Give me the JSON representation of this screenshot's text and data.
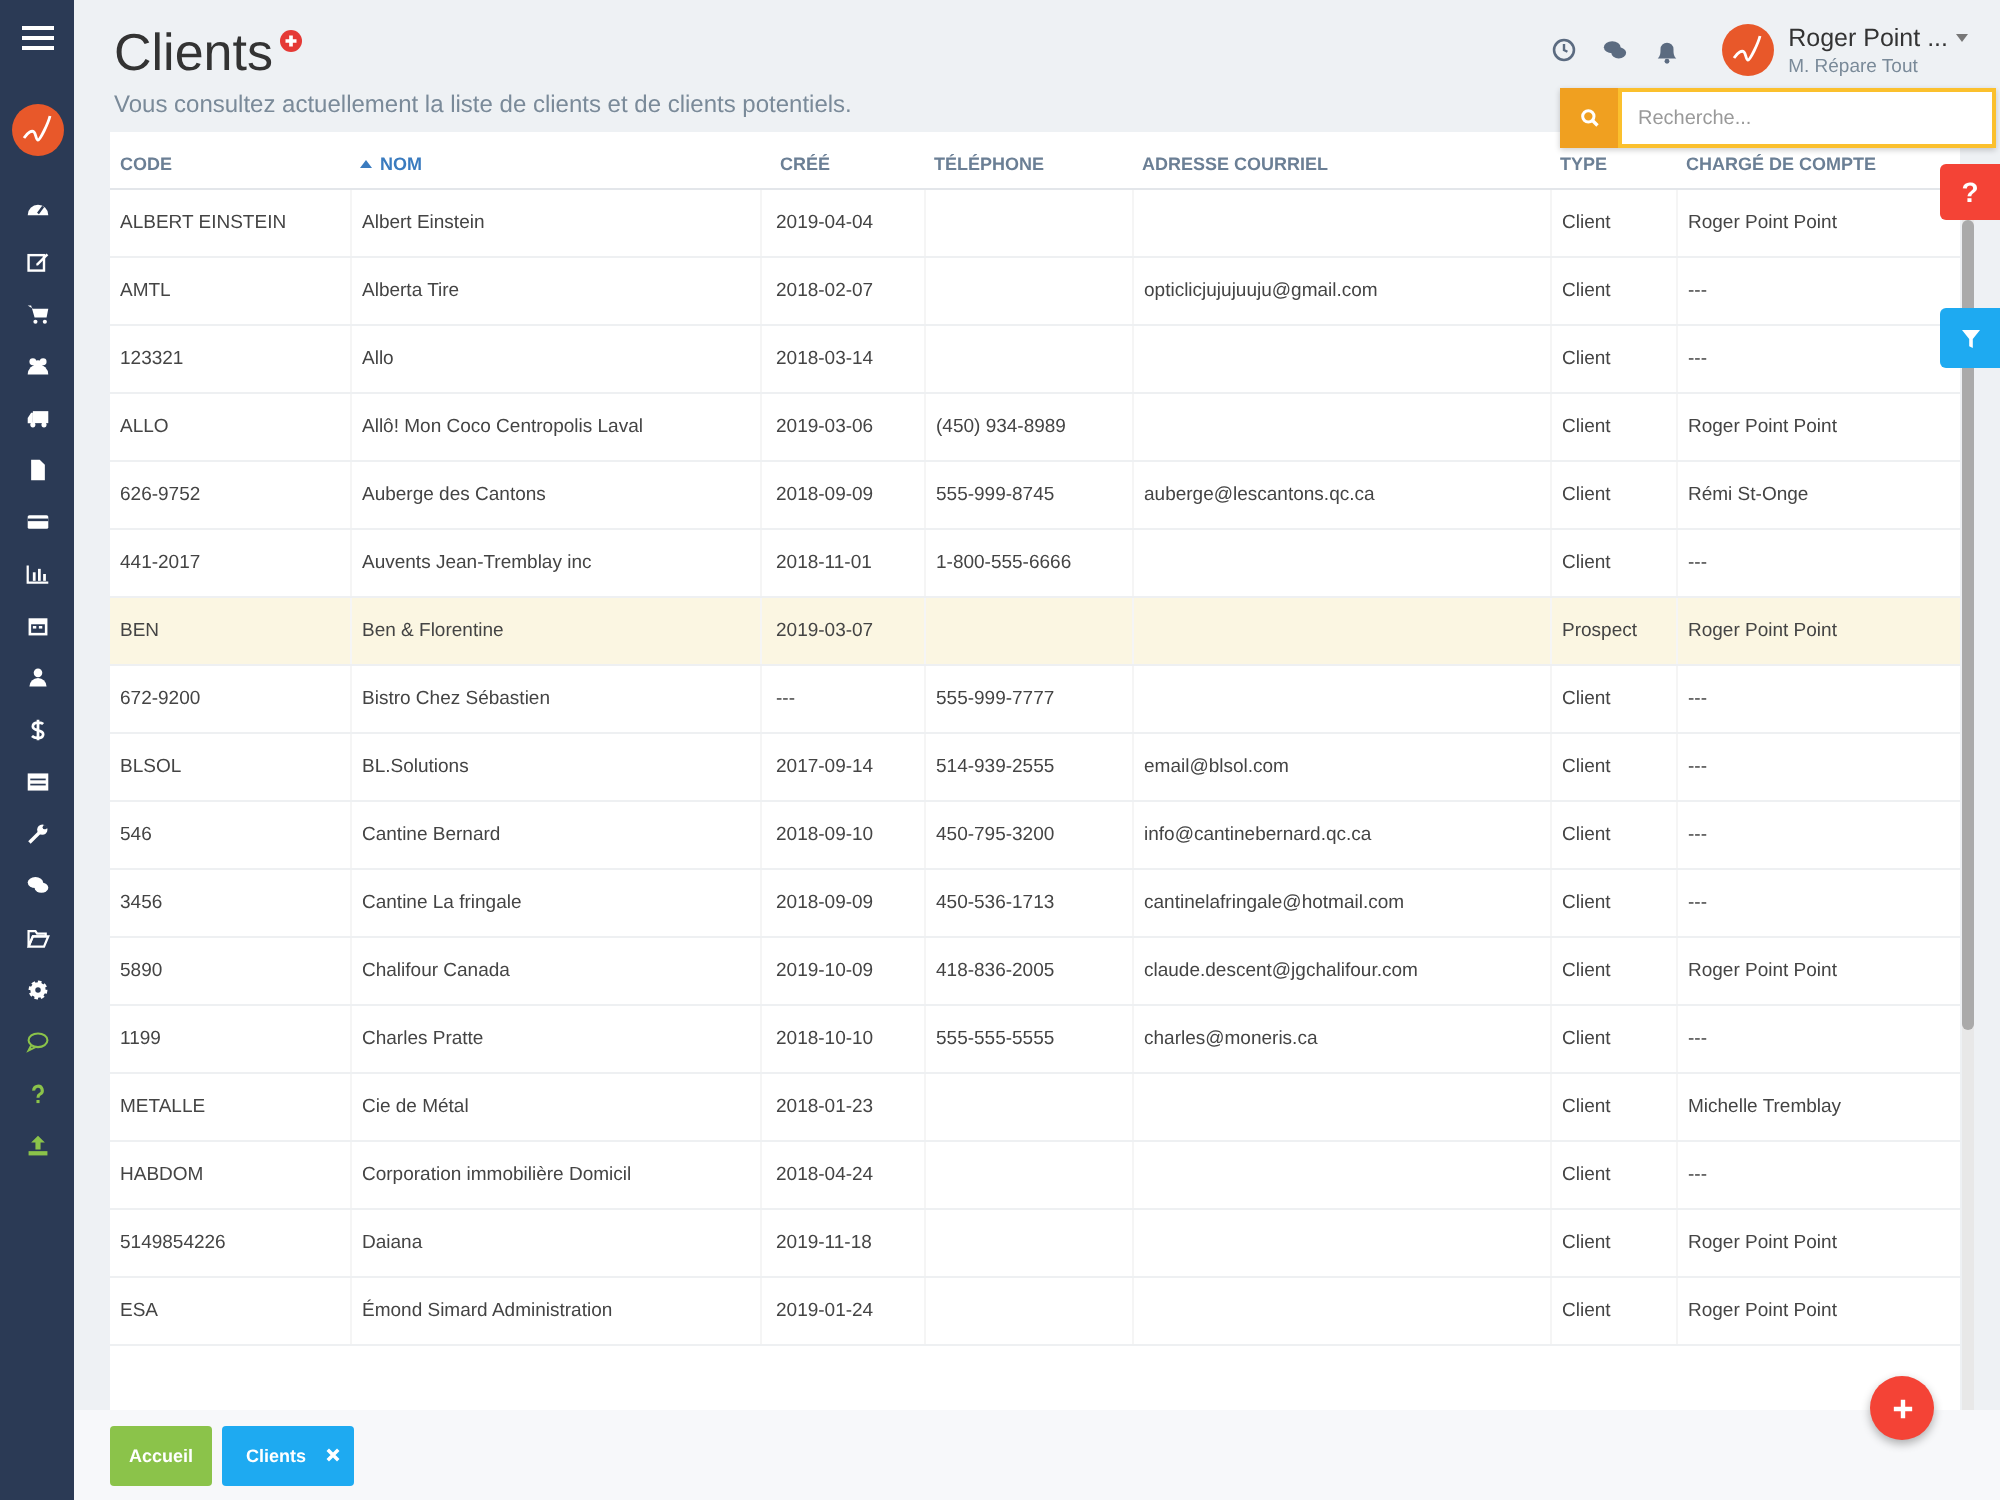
{
  "header": {
    "title": "Clients",
    "subtitle": "Vous consultez actuellement la liste de clients et de clients potentiels."
  },
  "user": {
    "name": "Roger Point ...",
    "company": "M. Répare Tout"
  },
  "search": {
    "placeholder": "Recherche..."
  },
  "help_tab": {
    "label": "?"
  },
  "table": {
    "columns": [
      {
        "label": "CODE",
        "sorted": false
      },
      {
        "label": "NOM",
        "sorted": true
      },
      {
        "label": "CRÉÉ",
        "sorted": false
      },
      {
        "label": "TÉLÉPHONE",
        "sorted": false
      },
      {
        "label": "ADRESSE COURRIEL",
        "sorted": false
      },
      {
        "label": "TYPE",
        "sorted": false
      },
      {
        "label": "CHARGÉ DE COMPTE",
        "sorted": false
      }
    ],
    "rows": [
      {
        "code": "ALBERT EINSTEIN",
        "name": "Albert Einstein",
        "created": "2019-04-04",
        "type": "Client",
        "manager": "Roger Point Point",
        "selected": false
      },
      {
        "code": "AMTL",
        "name": "Alberta Tire",
        "created": "2018-02-07",
        "email": "opticlicjujujuuju@gmail.com",
        "type": "Client",
        "manager": "---",
        "selected": false
      },
      {
        "code": "123321",
        "name": "Allo",
        "created": "2018-03-14",
        "type": "Client",
        "manager": "---",
        "selected": false
      },
      {
        "code": "ALLO",
        "name": "Allô! Mon Coco Centropolis Laval",
        "created": "2019-03-06",
        "phone": "(450) 934-8989",
        "type": "Client",
        "manager": "Roger Point Point",
        "selected": false
      },
      {
        "code": "626-9752",
        "name": "Auberge des Cantons",
        "created": "2018-09-09",
        "phone": "555-999-8745",
        "email": "auberge@lescantons.qc.ca",
        "type": "Client",
        "manager": "Rémi St-Onge",
        "selected": false
      },
      {
        "code": "441-2017",
        "name": "Auvents Jean-Tremblay inc",
        "created": "2018-11-01",
        "phone": "1-800-555-6666",
        "type": "Client",
        "manager": "---",
        "selected": false
      },
      {
        "code": "BEN",
        "name": "Ben & Florentine",
        "created": "2019-03-07",
        "type": "Prospect",
        "manager": "Roger Point Point",
        "selected": true
      },
      {
        "code": "672-9200",
        "name": "Bistro Chez Sébastien",
        "created": "---",
        "phone": "555-999-7777",
        "type": "Client",
        "manager": "---",
        "selected": false
      },
      {
        "code": "BLSOL",
        "name": "BL.Solutions",
        "created": "2017-09-14",
        "phone": "514-939-2555",
        "email": "email@blsol.com",
        "type": "Client",
        "manager": "---",
        "selected": false
      },
      {
        "code": "546",
        "name": "Cantine Bernard",
        "created": "2018-09-10",
        "phone": "450-795-3200",
        "email": "info@cantinebernard.qc.ca",
        "type": "Client",
        "manager": "---",
        "selected": false
      },
      {
        "code": "3456",
        "name": "Cantine La fringale",
        "created": "2018-09-09",
        "phone": "450-536-1713",
        "email": "cantinelafringale@hotmail.com",
        "type": "Client",
        "manager": "---",
        "selected": false
      },
      {
        "code": "5890",
        "name": "Chalifour Canada",
        "created": "2019-10-09",
        "phone": "418-836-2005",
        "email": "claude.descent@jgchalifour.com",
        "type": "Client",
        "manager": "Roger Point Point",
        "selected": false
      },
      {
        "code": "1199",
        "name": "Charles Pratte",
        "created": "2018-10-10",
        "phone": "555-555-5555",
        "email": "charles@moneris.ca",
        "type": "Client",
        "manager": "---",
        "selected": false
      },
      {
        "code": "METALLE",
        "name": "Cie de Métal",
        "created": "2018-01-23",
        "type": "Client",
        "manager": "Michelle Tremblay",
        "selected": false
      },
      {
        "code": "HABDOM",
        "name": "Corporation immobilière Domicil",
        "created": "2018-04-24",
        "type": "Client",
        "manager": "---",
        "selected": false
      },
      {
        "code": "5149854226",
        "name": "Daiana",
        "created": "2019-11-18",
        "type": "Client",
        "manager": "Roger Point Point",
        "selected": false
      },
      {
        "code": "ESA",
        "name": "Émond Simard Administration",
        "created": "2019-01-24",
        "type": "Client",
        "manager": "Roger Point Point",
        "selected": false
      }
    ]
  },
  "tabs": [
    {
      "label": "Accueil",
      "kind": "home",
      "closable": false
    },
    {
      "label": "Clients",
      "kind": "page",
      "closable": true
    }
  ]
}
